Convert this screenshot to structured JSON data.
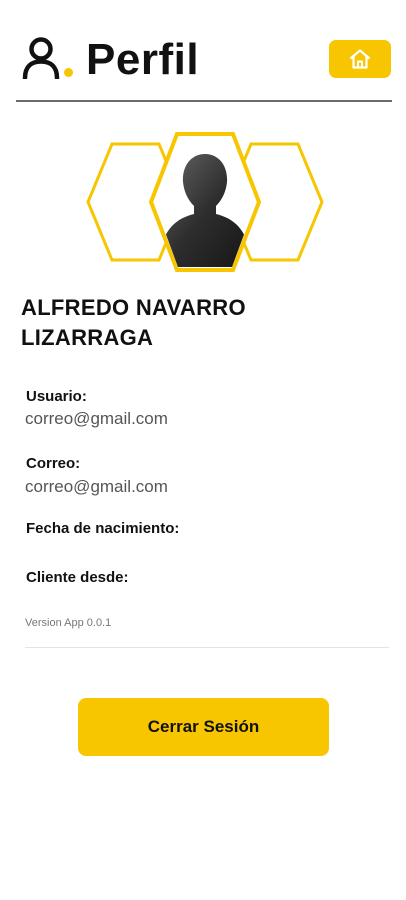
{
  "header": {
    "title": "Perfil",
    "user_icon": "user-outline-icon",
    "home_icon": "home-icon"
  },
  "colors": {
    "accent": "#F7C600",
    "text": "#111111",
    "muted": "#555555"
  },
  "profile": {
    "avatar_icon": "person-silhouette-icon",
    "name_line1": "ALFREDO NAVARRO",
    "name_line2": "LIZARRAGA"
  },
  "fields": {
    "usuario_label": "Usuario:",
    "usuario_value": "correo@gmail.com",
    "correo_label": "Correo:",
    "correo_value": "correo@gmail.com",
    "nacimiento_label": "Fecha de nacimiento:",
    "cliente_label": "Cliente desde:"
  },
  "footer": {
    "version": "Version App 0.0.1",
    "logout_label": "Cerrar Sesión"
  }
}
